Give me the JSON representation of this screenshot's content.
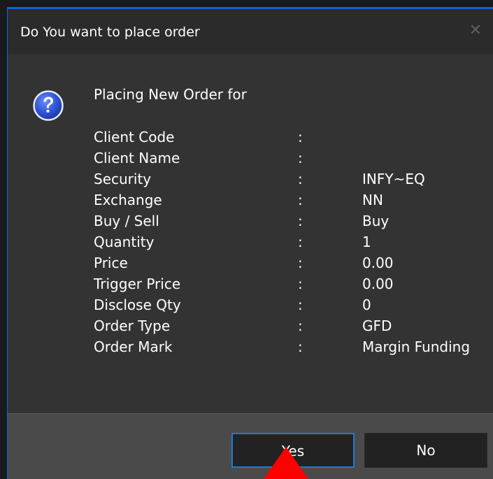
{
  "dialog": {
    "title": "Do You want to place order",
    "close_label": "✕",
    "heading": "Placing New Order for",
    "separator": ":",
    "rows": [
      {
        "label": "Client Code",
        "value": ""
      },
      {
        "label": "Client Name",
        "value": ""
      },
      {
        "label": "Security",
        "value": "INFY~EQ"
      },
      {
        "label": "Exchange",
        "value": "NN"
      },
      {
        "label": "Buy / Sell",
        "value": "Buy"
      },
      {
        "label": "Quantity",
        "value": "1"
      },
      {
        "label": "Price",
        "value": "0.00"
      },
      {
        "label": "Trigger Price",
        "value": "0.00"
      },
      {
        "label": "Disclose Qty",
        "value": "0"
      },
      {
        "label": "Order Type",
        "value": "GFD"
      },
      {
        "label": "Order Mark",
        "value": "Margin Funding"
      }
    ],
    "yes_label": "Yes",
    "no_label": "No",
    "icon": "question-icon"
  },
  "colors": {
    "accent": "#1e7bd6",
    "pointer": "#ff0000"
  }
}
